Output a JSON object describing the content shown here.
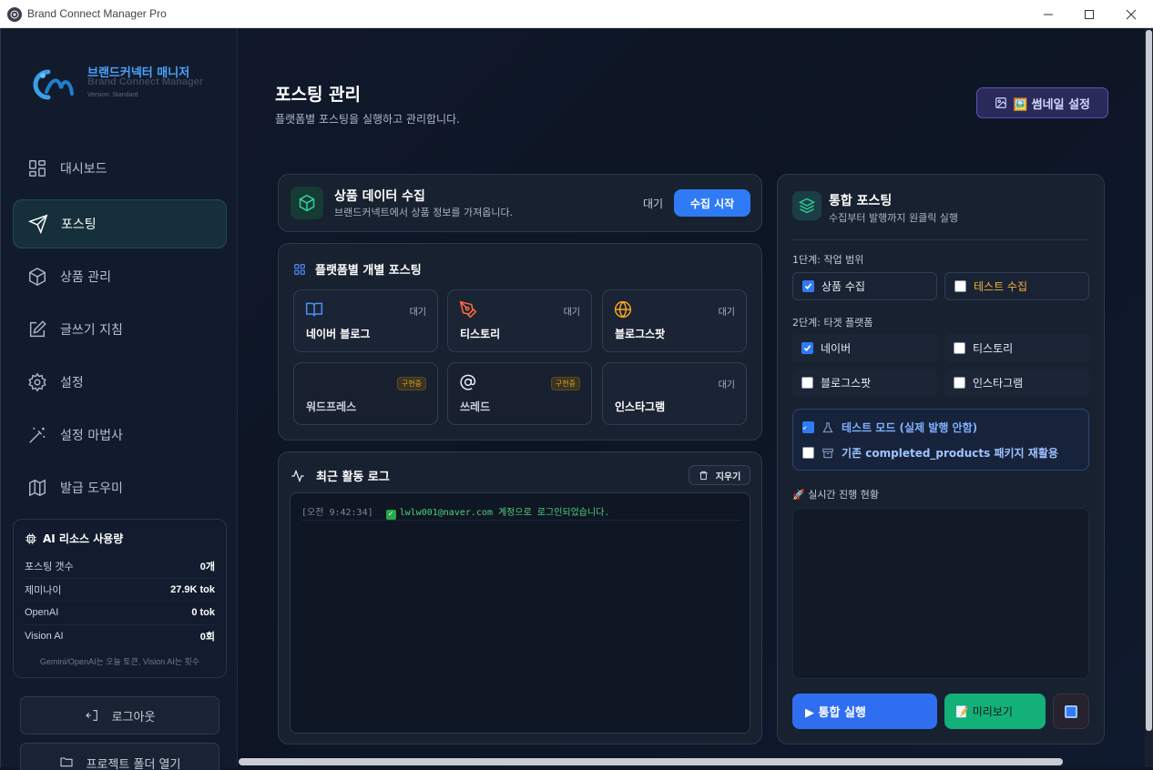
{
  "window": {
    "title": "Brand Connect Manager Pro"
  },
  "brand": {
    "name_kr": "브랜드커넥터 매니저",
    "name_en": "Brand Connect Manager",
    "version": "Version: Standard"
  },
  "nav": [
    {
      "label": "대시보드",
      "icon": "dashboard-icon"
    },
    {
      "label": "포스팅",
      "icon": "send-icon",
      "active": true
    },
    {
      "label": "상품 관리",
      "icon": "box-icon"
    },
    {
      "label": "글쓰기 지침",
      "icon": "edit-icon"
    },
    {
      "label": "설정",
      "icon": "gear-icon"
    },
    {
      "label": "설정 마법사",
      "icon": "wand-icon"
    },
    {
      "label": "발급 도우미",
      "icon": "map-icon"
    }
  ],
  "usage": {
    "title": "AI 리소스 사용량",
    "rows": [
      {
        "label": "포스팅 갯수",
        "value": "0개"
      },
      {
        "label": "제미나이",
        "value": "27.9K tok"
      },
      {
        "label": "OpenAI",
        "value": "0 tok"
      },
      {
        "label": "Vision AI",
        "value": "0회"
      }
    ],
    "note": "Gemini/OpenAI는 오늘 토큰, Vision AI는 횟수"
  },
  "sidebar_buttons": {
    "logout": "로그아웃",
    "open_folder": "프로젝트 폴더 열기"
  },
  "page": {
    "title": "포스팅 관리",
    "subtitle": "플랫폼별 포스팅을 실행하고 관리합니다.",
    "thumbnail_button": "🖼️ 썸네일 설정"
  },
  "collect": {
    "title": "상품 데이터 수집",
    "subtitle": "브랜드커넥트에서 상품 정보를 가져옵니다.",
    "status": "대기",
    "start_button": "수집 시작"
  },
  "platforms": {
    "title": "플랫폼별 개별 포스팅",
    "items": [
      {
        "name": "네이버 블로그",
        "status": "대기",
        "icon": "book-icon",
        "color": "#4d8dff"
      },
      {
        "name": "티스토리",
        "status": "대기",
        "icon": "pen-icon",
        "color": "#ff6a3d"
      },
      {
        "name": "블로그스팟",
        "status": "대기",
        "icon": "globe-icon",
        "color": "#f5a623"
      },
      {
        "name": "워드프레스",
        "status": "구현중",
        "icon": "",
        "color": ""
      },
      {
        "name": "쓰레드",
        "status": "구현중",
        "icon": "at-icon",
        "color": "#ffffff"
      },
      {
        "name": "인스타그램",
        "status": "대기",
        "icon": "",
        "color": ""
      }
    ]
  },
  "log": {
    "title": "최근 활동 로그",
    "clear_button": "지우기",
    "entries": [
      {
        "time": "[오전 9:42:34]",
        "message": "lwlw001@naver.com 계정으로 로그인되었습니다."
      }
    ]
  },
  "integrated": {
    "title": "통합 포스팅",
    "subtitle": "수집부터 발행까지 원클릭 실행",
    "step1_label": "1단계: 작업 범위",
    "step1": [
      {
        "label": "상품 수집",
        "checked": true
      },
      {
        "label": "테스트 수집",
        "checked": false
      }
    ],
    "step2_label": "2단계: 타겟 플랫폼",
    "step2": [
      {
        "label": "네이버",
        "checked": true
      },
      {
        "label": "티스토리",
        "checked": false
      },
      {
        "label": "블로그스팟",
        "checked": false
      },
      {
        "label": "인스타그램",
        "checked": false
      }
    ],
    "test_mode": {
      "label": "테스트 모드 (실제 발행 안함)",
      "checked": true
    },
    "reuse": {
      "label": "기존 completed_products 패키지 재활용",
      "checked": false
    },
    "progress_label": "🚀 실시간 진행 현황",
    "run_button": "▶ 통합 실행",
    "preview_button": "📝 미리보기"
  },
  "colors": {
    "accent": "#2f7bf5",
    "success": "#13b07a",
    "warning": "#d6a12c"
  }
}
